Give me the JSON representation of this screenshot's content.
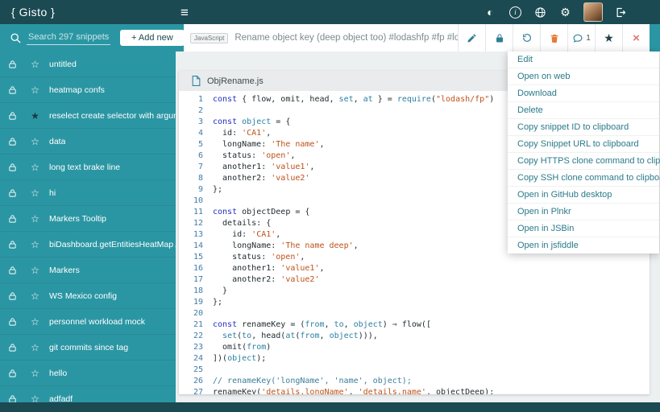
{
  "colors": {
    "topbar_bg": "#1b4a52",
    "teal_bg": "#2b96a3",
    "icon_teal": "#2e7f93",
    "menu_text": "#2b7a8a",
    "delete_orange": "#e87a33",
    "close_red": "#e57373",
    "star_filled": "#22404a",
    "line_number_blue": "#3f7ba8",
    "code_keyword": "#2230c0",
    "code_string": "#bf5019",
    "code_builtin": "#2d7fa3",
    "code_comment": "#3c7e9b"
  },
  "topbar": {
    "logo": "{ Gisto }"
  },
  "toolbar": {
    "search_placeholder": "Search 297 snippets",
    "add_new_label": "+ Add new",
    "language_badge": "JavaScript",
    "snippet_title": "Rename object key (deep object too) #lodashfp #fp #lodash #rename",
    "comment_count": "1"
  },
  "sidebar": {
    "items": [
      {
        "label": "untitled",
        "starred": false
      },
      {
        "label": "heatmap confs",
        "starred": false
      },
      {
        "label": "reselect create selector with arguments",
        "starred": true
      },
      {
        "label": "data",
        "starred": false
      },
      {
        "label": "long text brake line",
        "starred": false
      },
      {
        "label": "hi",
        "starred": false
      },
      {
        "label": "Markers Tooltip",
        "starred": false
      },
      {
        "label": "biDashboard.getEntitiesHeatMap API",
        "starred": false
      },
      {
        "label": "Markers",
        "starred": false
      },
      {
        "label": "WS Mexico config",
        "starred": false
      },
      {
        "label": "personnel workload mock",
        "starred": false
      },
      {
        "label": "git commits since tag",
        "starred": false
      },
      {
        "label": "hello",
        "starred": false
      },
      {
        "label": "adfadf",
        "starred": false
      }
    ]
  },
  "editor": {
    "filename": "ObjRename.js",
    "code_lines": [
      "const { flow, omit, head, set, at } = require(\"lodash/fp\")",
      "",
      "const object = {",
      "  id: 'CA1',",
      "  longName: 'The name',",
      "  status: 'open',",
      "  another1: 'value1',",
      "  another2: 'value2'",
      "};",
      "",
      "const objectDeep = {",
      "  details: {",
      "    id: 'CA1',",
      "    longName: 'The name deep',",
      "    status: 'open',",
      "    another1: 'value1',",
      "    another2: 'value2'",
      "  }",
      "};",
      "",
      "const renameKey = (from, to, object) ⇒ flow([",
      "  set(to, head(at(from, object))),",
      "  omit(from)",
      "])(object);",
      "",
      "// renameKey('longName', 'name', object);",
      "renameKey('details.longName', 'details.name', objectDeep);"
    ]
  },
  "menu": {
    "items": [
      "Edit",
      "Open on web",
      "Download",
      "Delete",
      "Copy snippet ID to clipboard",
      "Copy Snippet URL to clipboard",
      "Copy HTTPS clone command to clipboard",
      "Copy SSH clone command to clipboard",
      "Open in GitHub desktop",
      "Open in Plnkr",
      "Open in JSBin",
      "Open in jsfiddle"
    ]
  }
}
